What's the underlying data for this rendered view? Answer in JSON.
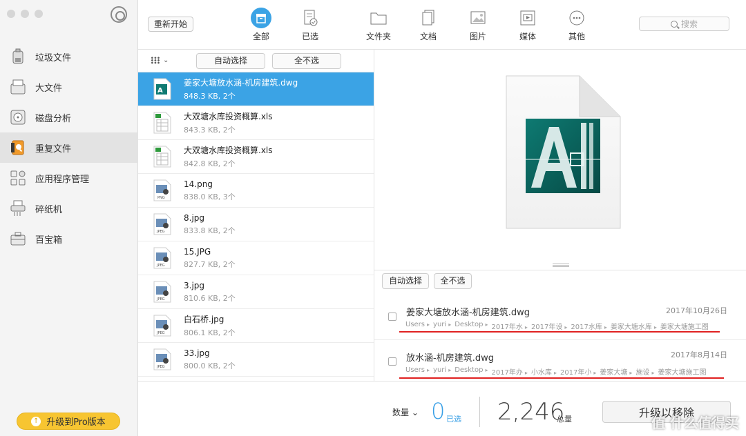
{
  "sidebar": {
    "items": [
      {
        "label": "垃圾文件",
        "icon": "trash-bin-icon"
      },
      {
        "label": "大文件",
        "icon": "large-file-icon"
      },
      {
        "label": "磁盘分析",
        "icon": "disk-analysis-icon"
      },
      {
        "label": "重复文件",
        "icon": "duplicate-files-icon",
        "active": true
      },
      {
        "label": "应用程序管理",
        "icon": "app-manager-icon"
      },
      {
        "label": "碎纸机",
        "icon": "shredder-icon"
      },
      {
        "label": "百宝箱",
        "icon": "toolbox-icon"
      }
    ],
    "upgrade_label": "升级到Pro版本"
  },
  "toolbar": {
    "restart_label": "重新开始",
    "tabs": [
      {
        "label": "全部",
        "icon": "all-box-icon",
        "active": true
      },
      {
        "label": "已选",
        "icon": "selected-doc-icon"
      },
      {
        "label": "文件夹",
        "icon": "folder-icon"
      },
      {
        "label": "文档",
        "icon": "document-icon"
      },
      {
        "label": "图片",
        "icon": "image-icon"
      },
      {
        "label": "媒体",
        "icon": "media-icon"
      },
      {
        "label": "其他",
        "icon": "other-icon"
      }
    ],
    "search_placeholder": "搜索"
  },
  "list": {
    "auto_select_label": "自动选择",
    "deselect_all_label": "全不选",
    "files": [
      {
        "name": "姜家大塘放水涵-机房建筑.dwg",
        "meta": "848.3 KB, 2个",
        "type": "dwg"
      },
      {
        "name": "大双塘水库投资概算.xls",
        "meta": "843.3 KB, 2个",
        "type": "xls"
      },
      {
        "name": "大双塘水库投资概算.xls",
        "meta": "842.8 KB, 2个",
        "type": "xls"
      },
      {
        "name": "14.png",
        "meta": "838.0 KB, 3个",
        "type": "png"
      },
      {
        "name": "8.jpg",
        "meta": "833.8 KB, 2个",
        "type": "jpg"
      },
      {
        "name": "15.JPG",
        "meta": "827.7 KB, 2个",
        "type": "jpg"
      },
      {
        "name": "3.jpg",
        "meta": "810.6 KB, 2个",
        "type": "jpg"
      },
      {
        "name": "白石桥.jpg",
        "meta": "806.1 KB, 2个",
        "type": "jpg"
      },
      {
        "name": "33.jpg",
        "meta": "800.0 KB, 2个",
        "type": "jpg"
      }
    ]
  },
  "duplicates": {
    "auto_select_label": "自动选择",
    "deselect_all_label": "全不选",
    "entries": [
      {
        "name": "姜家大塘放水涵-机房建筑.dwg",
        "date": "2017年10月26日",
        "path": [
          "Users",
          "yuri",
          "Desktop",
          "2017年水",
          "2017年设",
          "2017水库",
          "姜家大塘水库",
          "姜家大塘施工图"
        ]
      },
      {
        "name": "放水涵-机房建筑.dwg",
        "date": "2017年8月14日",
        "path": [
          "Users",
          "yuri",
          "Desktop",
          "2017年办",
          "小水库",
          "2017年小",
          "姜家大塘",
          "施设",
          "姜家大塘施工图"
        ]
      }
    ]
  },
  "bottom": {
    "count_label": "数量",
    "selected_count": "0",
    "selected_unit": "已选",
    "total_count": "2,246",
    "total_unit": "总量",
    "remove_label": "升级以移除"
  },
  "watermark": "值 什么值得买",
  "colors": {
    "accent": "#3ba3e5",
    "upgrade": "#f7c531",
    "underline": "#e02020"
  }
}
